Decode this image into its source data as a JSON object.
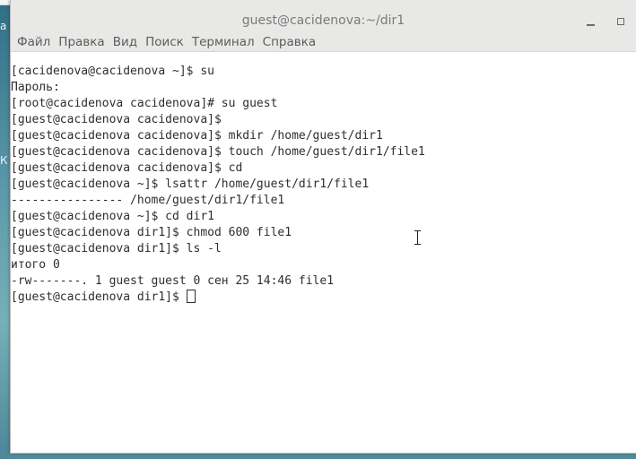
{
  "desktop": {
    "side_glyphs": [
      "а",
      "К"
    ]
  },
  "window": {
    "title": "guest@cacidenova:~/dir1"
  },
  "menu": {
    "items": [
      "Файл",
      "Правка",
      "Вид",
      "Поиск",
      "Терминал",
      "Справка"
    ]
  },
  "terminal": {
    "lines": [
      "[cacidenova@cacidenova ~]$ su",
      "Пароль:",
      "[root@cacidenova cacidenova]# su guest",
      "[guest@cacidenova cacidenova]$",
      "[guest@cacidenova cacidenova]$ mkdir /home/guest/dir1",
      "[guest@cacidenova cacidenova]$ touch /home/guest/dir1/file1",
      "[guest@cacidenova cacidenova]$ cd",
      "[guest@cacidenova ~]$ lsattr /home/guest/dir1/file1",
      "---------------- /home/guest/dir1/file1",
      "[guest@cacidenova ~]$ cd dir1",
      "[guest@cacidenova dir1]$ chmod 600 file1",
      "[guest@cacidenova dir1]$ ls -l",
      "итого 0",
      "-rw-------. 1 guest guest 0 сен 25 14:46 file1"
    ],
    "prompt": "[guest@cacidenova dir1]$ "
  },
  "colors": {
    "terminal_bg": "#ffffff",
    "terminal_fg": "#2e2e2e",
    "chrome_bg": "#e8e8e7"
  }
}
